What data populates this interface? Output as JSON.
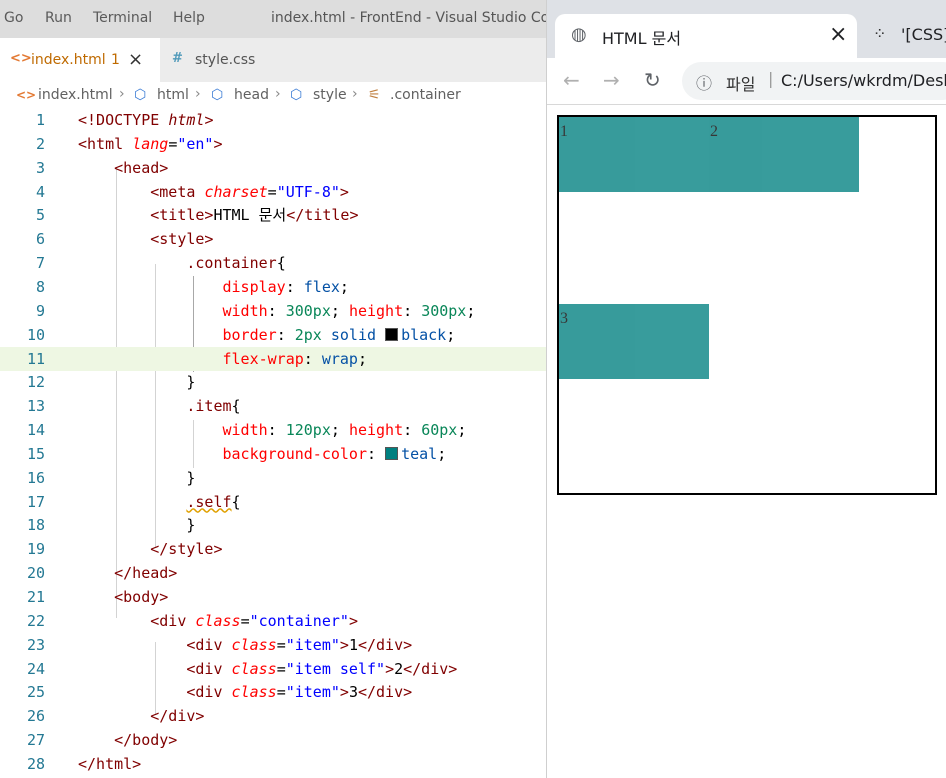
{
  "menubar": {
    "items": [
      "Go",
      "Run",
      "Terminal",
      "Help"
    ],
    "window_title": "index.html - FrontEnd - Visual Studio Code"
  },
  "tabs": [
    {
      "label": "index.html",
      "badge": "1",
      "icon": "html-icon",
      "close": "×"
    },
    {
      "label": "style.css",
      "icon": "css-hash-icon",
      "close": ""
    }
  ],
  "breadcrumb": [
    "index.html",
    "html",
    "head",
    "style",
    ".container"
  ],
  "editor": {
    "lines": [
      {
        "n": "1",
        "html": "<span class='t-doc'>&lt;!DOCTYPE <i>html</i>&gt;</span>"
      },
      {
        "n": "2",
        "html": "<span class='t-tag'>&lt;html</span> <span class='t-attr'>lang</span>=<span class='t-str'>\"en\"</span><span class='t-tag'>&gt;</span>"
      },
      {
        "n": "3",
        "html": "    <span class='t-tag'>&lt;head&gt;</span>"
      },
      {
        "n": "4",
        "html": "        <span class='t-tag'>&lt;meta</span> <span class='t-attr'>charset</span>=<span class='t-str'>\"UTF-8\"</span><span class='t-tag'>&gt;</span>"
      },
      {
        "n": "5",
        "html": "        <span class='t-tag'>&lt;title&gt;</span><span class='t-txt'>HTML 문서</span><span class='t-tag'>&lt;/title&gt;</span>"
      },
      {
        "n": "6",
        "html": "        <span class='t-tag'>&lt;style&gt;</span>"
      },
      {
        "n": "7",
        "html": "            <span class='t-sel'>.container</span><span class='t-txt'>{</span>"
      },
      {
        "n": "8",
        "html": "                <span class='t-prop'>display</span>: <span class='t-val'>flex</span>;"
      },
      {
        "n": "9",
        "html": "                <span class='t-prop'>width</span>: <span class='t-num'>300px</span>; <span class='t-prop'>height</span>: <span class='t-num'>300px</span>;"
      },
      {
        "n": "10",
        "html": "                <span class='t-prop'>border</span>: <span class='t-num'>2px</span> <span class='t-val'>solid</span> <span class='swatch' style='background:#000'></span><span class='t-val'>black</span>;"
      },
      {
        "n": "11",
        "html": "                <span class='t-prop'>flex-wrap</span>: <span class='t-val'>wrap</span>;"
      },
      {
        "n": "12",
        "html": "            <span class='t-txt'>}</span>"
      },
      {
        "n": "13",
        "html": "            <span class='t-sel'>.item</span><span class='t-txt'>{</span>"
      },
      {
        "n": "14",
        "html": "                <span class='t-prop'>width</span>: <span class='t-num'>120px</span>; <span class='t-prop'>height</span>: <span class='t-num'>60px</span>;"
      },
      {
        "n": "15",
        "html": "                <span class='t-prop'>background-color</span>: <span class='swatch' style='background:#008080'></span><span class='t-val'>teal</span>;"
      },
      {
        "n": "16",
        "html": "            <span class='t-txt'>}</span>"
      },
      {
        "n": "17",
        "html": "            <span class='t-sel wavy'>.self</span><span class='t-txt'>{</span>"
      },
      {
        "n": "18",
        "html": "            <span class='t-txt'>}</span>"
      },
      {
        "n": "19",
        "html": "        <span class='t-tag'>&lt;/style&gt;</span>"
      },
      {
        "n": "20",
        "html": "    <span class='t-tag'>&lt;/head&gt;</span>"
      },
      {
        "n": "21",
        "html": "    <span class='t-tag'>&lt;body&gt;</span>"
      },
      {
        "n": "22",
        "html": "        <span class='t-tag'>&lt;div</span> <span class='t-attr'>class</span>=<span class='t-str'>\"container\"</span><span class='t-tag'>&gt;</span>"
      },
      {
        "n": "23",
        "html": "            <span class='t-tag'>&lt;div</span> <span class='t-attr'>class</span>=<span class='t-str'>\"item\"</span><span class='t-tag'>&gt;</span><span class='t-txt'>1</span><span class='t-tag'>&lt;/div&gt;</span>"
      },
      {
        "n": "24",
        "html": "            <span class='t-tag'>&lt;div</span> <span class='t-attr'>class</span>=<span class='t-str'>\"item self\"</span><span class='t-tag'>&gt;</span><span class='t-txt'>2</span><span class='t-tag'>&lt;/div&gt;</span>"
      },
      {
        "n": "25",
        "html": "            <span class='t-tag'>&lt;div</span> <span class='t-attr'>class</span>=<span class='t-str'>\"item\"</span><span class='t-tag'>&gt;</span><span class='t-txt'>3</span><span class='t-tag'>&lt;/div&gt;</span>"
      },
      {
        "n": "26",
        "html": "        <span class='t-tag'>&lt;/div&gt;</span>"
      },
      {
        "n": "27",
        "html": "    <span class='t-tag'>&lt;/body&gt;</span>"
      },
      {
        "n": "28",
        "html": "<span class='t-tag'>&lt;/html&gt;</span>"
      }
    ],
    "highlight_line": "11"
  },
  "browser": {
    "tab_title": "HTML 문서",
    "tab_close": "×",
    "tab2_title": "'[CSS]",
    "omnibox_label": "파일",
    "url": "C:/Users/wkrdm/Desk",
    "items": [
      "1",
      "2",
      "3"
    ],
    "item_color": "#008080"
  }
}
